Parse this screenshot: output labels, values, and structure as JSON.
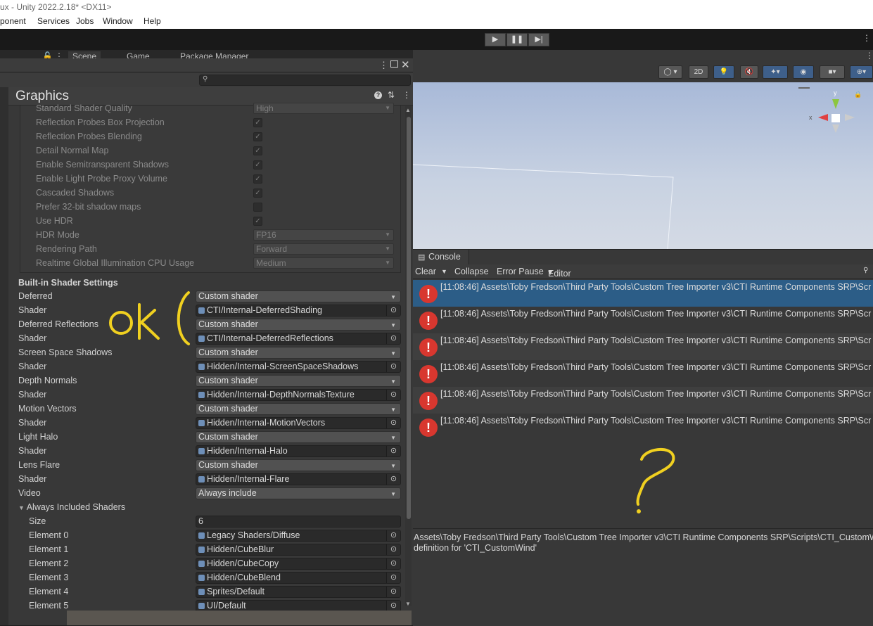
{
  "window": {
    "title": "ux - Unity 2022.2.18* <DX11>"
  },
  "menu": [
    "ponent",
    "Services",
    "Jobs",
    "Window",
    "Help"
  ],
  "toolbar": {
    "play_icons": [
      "play-icon",
      "pause-icon",
      "step-icon"
    ]
  },
  "left_tabs": [
    "Scene",
    "Game",
    "Package Manager"
  ],
  "inspector": {
    "title": "Graphics",
    "tier_settings": [
      {
        "label": "Standard Shader Quality",
        "type": "dropdown",
        "value": "High"
      },
      {
        "label": "Reflection Probes Box Projection",
        "type": "checkbox",
        "checked": true
      },
      {
        "label": "Reflection Probes Blending",
        "type": "checkbox",
        "checked": true
      },
      {
        "label": "Detail Normal Map",
        "type": "checkbox",
        "checked": true
      },
      {
        "label": "Enable Semitransparent Shadows",
        "type": "checkbox",
        "checked": true
      },
      {
        "label": "Enable Light Probe Proxy Volume",
        "type": "checkbox",
        "checked": true
      },
      {
        "label": "Cascaded Shadows",
        "type": "checkbox",
        "checked": true
      },
      {
        "label": "Prefer 32-bit shadow maps",
        "type": "checkbox",
        "checked": false
      },
      {
        "label": "Use HDR",
        "type": "checkbox",
        "checked": true
      },
      {
        "label": "HDR Mode",
        "type": "dropdown",
        "value": "FP16"
      },
      {
        "label": "Rendering Path",
        "type": "dropdown",
        "value": "Forward"
      },
      {
        "label": "Realtime Global Illumination CPU Usage",
        "type": "dropdown",
        "value": "Medium"
      }
    ],
    "builtin_header": "Built-in Shader Settings",
    "builtin": [
      {
        "label": "Deferred",
        "type": "dropdown",
        "value": "Custom shader"
      },
      {
        "label": "Shader",
        "type": "object",
        "value": "CTI/Internal-DeferredShading"
      },
      {
        "label": "Deferred Reflections",
        "type": "dropdown",
        "value": "Custom shader"
      },
      {
        "label": "Shader",
        "type": "object",
        "value": "CTI/Internal-DeferredReflections"
      },
      {
        "label": "Screen Space Shadows",
        "type": "dropdown",
        "value": "Custom shader"
      },
      {
        "label": "Shader",
        "type": "object",
        "value": "Hidden/Internal-ScreenSpaceShadows"
      },
      {
        "label": "Depth Normals",
        "type": "dropdown",
        "value": "Custom shader"
      },
      {
        "label": "Shader",
        "type": "object",
        "value": "Hidden/Internal-DepthNormalsTexture"
      },
      {
        "label": "Motion Vectors",
        "type": "dropdown",
        "value": "Custom shader"
      },
      {
        "label": "Shader",
        "type": "object",
        "value": "Hidden/Internal-MotionVectors"
      },
      {
        "label": "Light Halo",
        "type": "dropdown",
        "value": "Custom shader"
      },
      {
        "label": "Shader",
        "type": "object",
        "value": "Hidden/Internal-Halo"
      },
      {
        "label": "Lens Flare",
        "type": "dropdown",
        "value": "Custom shader"
      },
      {
        "label": "Shader",
        "type": "object",
        "value": "Hidden/Internal-Flare"
      },
      {
        "label": "Video",
        "type": "dropdown",
        "value": "Always include"
      }
    ],
    "always_included": {
      "label": "Always Included Shaders",
      "size_label": "Size",
      "size": "6",
      "elements": [
        {
          "label": "Element 0",
          "value": "Legacy Shaders/Diffuse"
        },
        {
          "label": "Element 1",
          "value": "Hidden/CubeBlur"
        },
        {
          "label": "Element 2",
          "value": "Hidden/CubeCopy"
        },
        {
          "label": "Element 3",
          "value": "Hidden/CubeBlend"
        },
        {
          "label": "Element 4",
          "value": "Sprites/Default"
        },
        {
          "label": "Element 5",
          "value": "UI/Default"
        }
      ]
    }
  },
  "annotations": {
    "ok_text": "ok (",
    "question": "?"
  },
  "scene": {
    "btn_2d": "2D",
    "gizmo_axes": [
      "y",
      "x"
    ]
  },
  "console": {
    "tab": "Console",
    "toolbar": {
      "clear": "Clear",
      "collapse": "Collapse",
      "error_pause": "Error Pause",
      "editor": "Editor"
    },
    "entries": [
      "[11:08:46] Assets\\Toby Fredson\\Third Party Tools\\Custom Tree Importer v3\\CTI Runtime Components SRP\\Scr",
      "[11:08:46] Assets\\Toby Fredson\\Third Party Tools\\Custom Tree Importer v3\\CTI Runtime Components SRP\\Scr",
      "[11:08:46] Assets\\Toby Fredson\\Third Party Tools\\Custom Tree Importer v3\\CTI Runtime Components SRP\\Scr",
      "[11:08:46] Assets\\Toby Fredson\\Third Party Tools\\Custom Tree Importer v3\\CTI Runtime Components SRP\\Scr",
      "[11:08:46] Assets\\Toby Fredson\\Third Party Tools\\Custom Tree Importer v3\\CTI Runtime Components SRP\\Scr",
      "[11:08:46] Assets\\Toby Fredson\\Third Party Tools\\Custom Tree Importer v3\\CTI Runtime Components SRP\\Scr"
    ],
    "detail_line1": "Assets\\Toby Fredson\\Third Party Tools\\Custom Tree Importer v3\\CTI Runtime Components SRP\\Scripts\\CTI_CustomW",
    "detail_line2": "definition for 'CTI_CustomWind'"
  },
  "colors": {
    "error": "#d8372f",
    "selection": "#2c5d87",
    "annotation": "#f0d020"
  }
}
